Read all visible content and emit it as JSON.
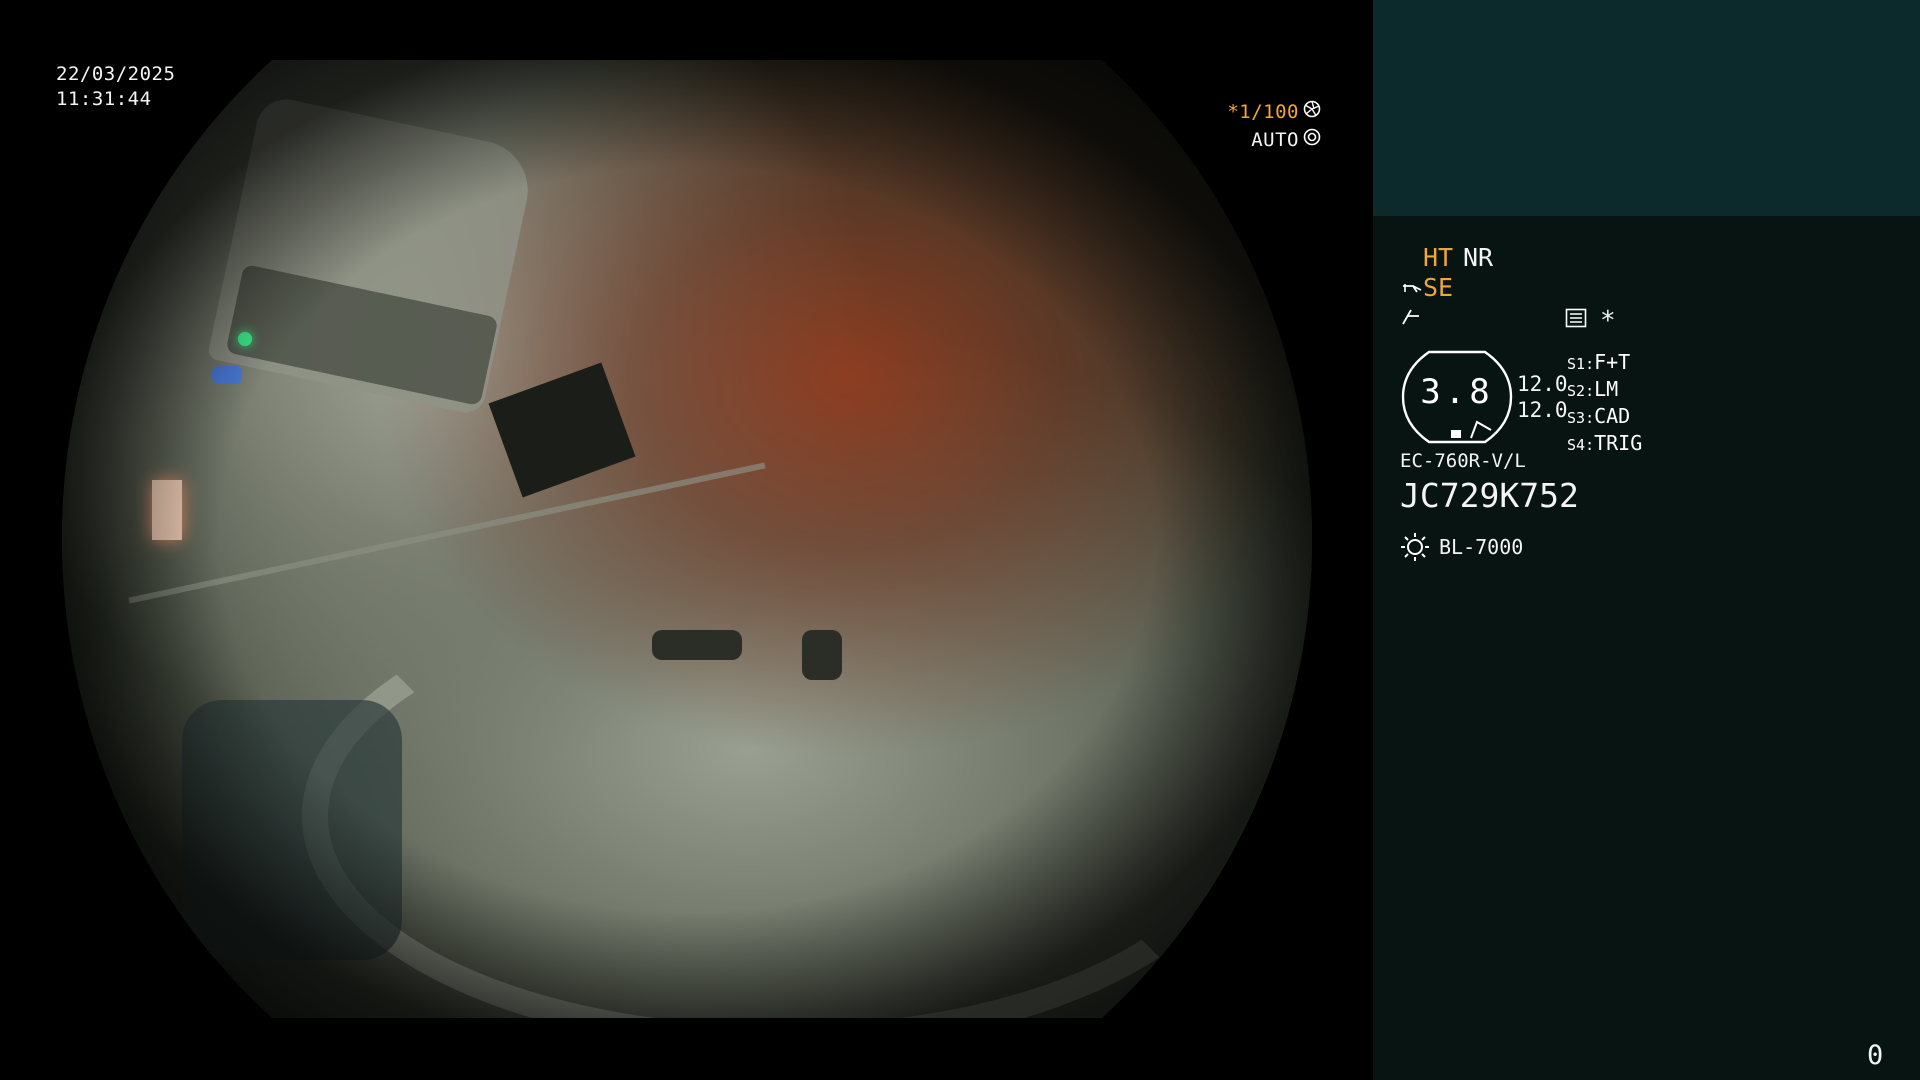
{
  "overlay": {
    "date": "22/03/2025",
    "time": "11:31:44",
    "shutter": "*1/100",
    "iris_mode": "AUTO"
  },
  "panel": {
    "mode_ht": "HT",
    "mode_nr": "NR",
    "mode_se": "SE",
    "menu_star": "*",
    "zoom_value": "3.8",
    "value_top": "12.0",
    "value_bottom": "12.0",
    "switches": [
      {
        "key": "S1",
        "label": "F+T"
      },
      {
        "key": "S2",
        "label": "LM"
      },
      {
        "key": "S3",
        "label": "CAD"
      },
      {
        "key": "S4",
        "label": "TRIG"
      }
    ],
    "scope_model": "EC-760R-V/L",
    "serial": "JC729K752",
    "light_source": "BL-7000",
    "counter": "0"
  },
  "colors": {
    "accent_orange": "#f0a63c",
    "panel_bg": "#071412",
    "panel_top_bg": "#0c2a2b",
    "text": "#f4f4f4"
  },
  "icons": {
    "shutter": "aperture-icon",
    "iris": "iris-icon",
    "se": "scope-tip-icon",
    "nr": "signal-icon",
    "settings": "settings-list-icon",
    "light": "sun-icon"
  }
}
